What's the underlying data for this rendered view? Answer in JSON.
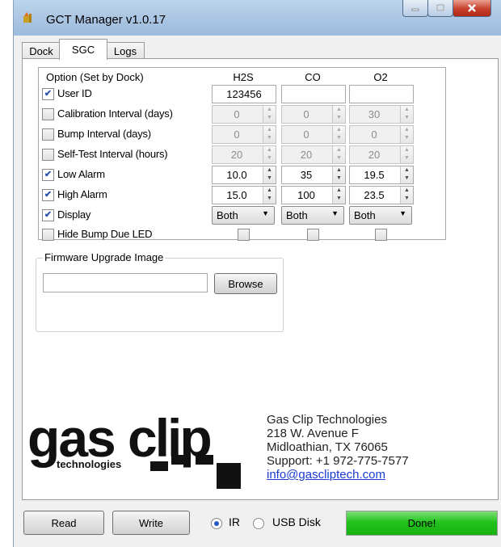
{
  "window": {
    "title": "GCT Manager v1.0.17"
  },
  "tabs": [
    {
      "label": "Dock"
    },
    {
      "label": "SGC"
    },
    {
      "label": "Logs"
    }
  ],
  "options": {
    "header": "Option (Set by Dock)",
    "columns": [
      "H2S",
      "CO",
      "O2"
    ],
    "rows": [
      {
        "label": "User ID",
        "checked": true,
        "type": "text",
        "values": [
          "123456",
          "",
          ""
        ]
      },
      {
        "label": "Calibration Interval (days)",
        "checked": false,
        "type": "spin",
        "disabled": true,
        "values": [
          "0",
          "0",
          "30"
        ]
      },
      {
        "label": "Bump Interval (days)",
        "checked": false,
        "type": "spin",
        "disabled": true,
        "values": [
          "0",
          "0",
          "0"
        ]
      },
      {
        "label": "Self-Test Interval (hours)",
        "checked": false,
        "type": "spin",
        "disabled": true,
        "values": [
          "20",
          "20",
          "20"
        ]
      },
      {
        "label": "Low Alarm",
        "checked": true,
        "type": "spin",
        "disabled": false,
        "values": [
          "10.0",
          "35",
          "19.5"
        ]
      },
      {
        "label": "High Alarm",
        "checked": true,
        "type": "spin",
        "disabled": false,
        "values": [
          "15.0",
          "100",
          "23.5"
        ]
      },
      {
        "label": "Display",
        "checked": true,
        "type": "combo",
        "values": [
          "Both",
          "Both",
          "Both"
        ]
      },
      {
        "label": "Hide Bump Due LED",
        "checked": false,
        "type": "checkbox",
        "values": [
          false,
          false,
          false
        ]
      }
    ]
  },
  "firmware": {
    "legend": "Firmware Upgrade Image",
    "path_value": "",
    "browse_label": "Browse"
  },
  "logo": {
    "word1": "gas",
    "word2": "clip",
    "sub": "technologies"
  },
  "company": {
    "name": "Gas Clip Technologies",
    "street": "218 W. Avenue F",
    "city": "Midloathian,  TX 76065",
    "support": "Support:  +1  972-775-7577",
    "email": "info@gascliptech.com"
  },
  "footer": {
    "read_label": "Read",
    "write_label": "Write",
    "radio_ir": "IR",
    "radio_usb": "USB Disk",
    "selected": "IR",
    "progress_percent": 100,
    "status": "Done!"
  },
  "colors": {
    "progress_green": "#22c31c",
    "link_blue": "#1a3ad0",
    "check_blue": "#2a52a8"
  }
}
